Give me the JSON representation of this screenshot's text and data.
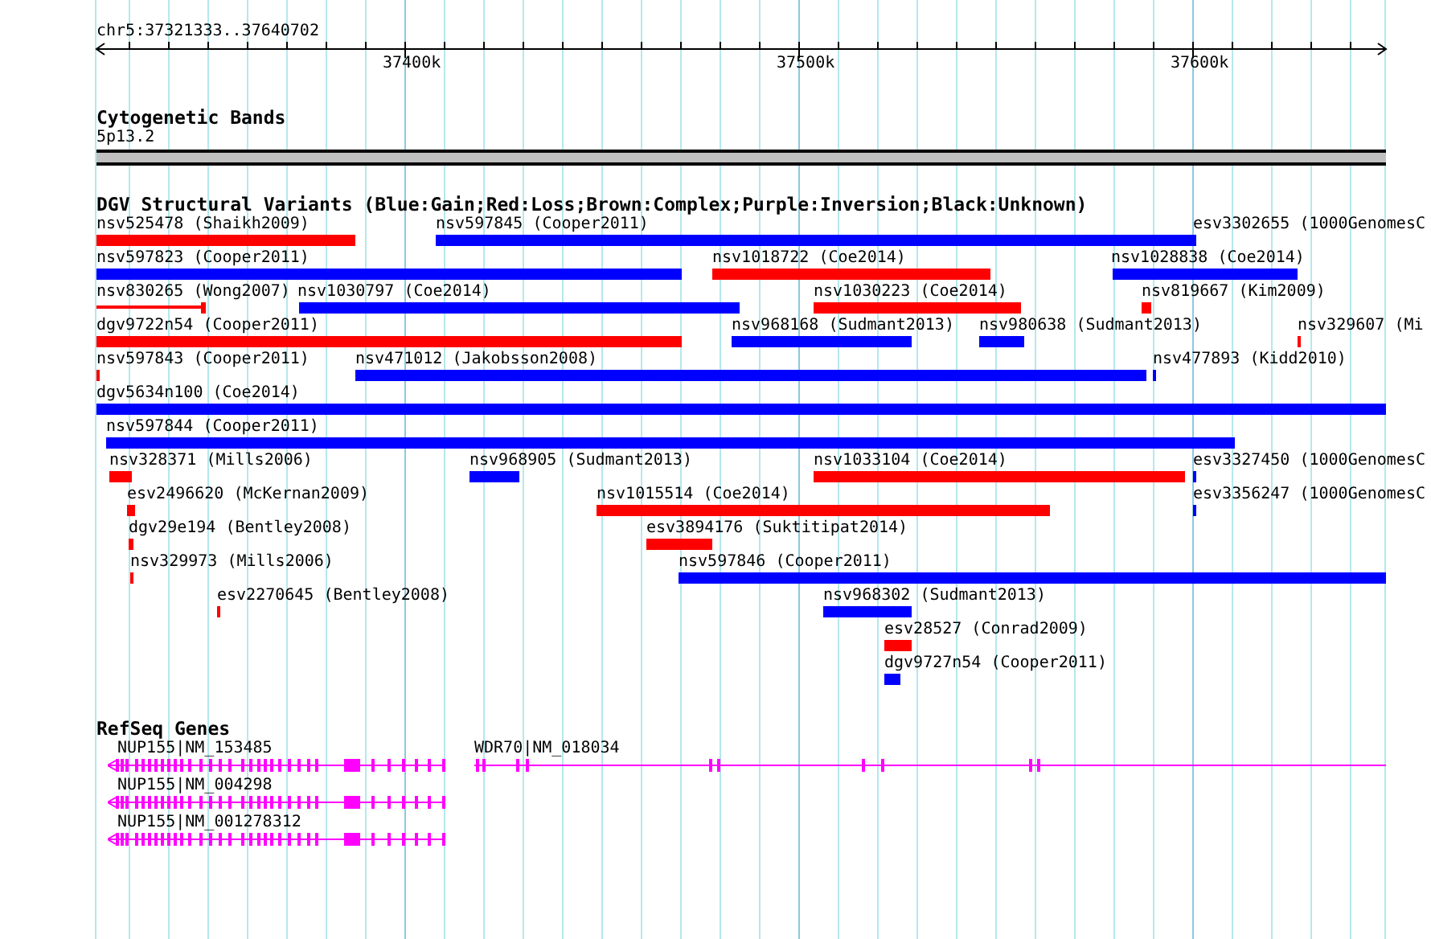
{
  "ruler": {
    "region": "chr5:37321333..37640702",
    "ticks": [
      "37400k",
      "37500k",
      "37600k"
    ]
  },
  "cytogenetic_bands": {
    "title": "Cytogenetic Bands",
    "band": "5p13.2"
  },
  "dgv": {
    "title": "DGV Structural Variants (Blue:Gain;Red:Loss;Brown:Complex;Purple:Inversion;Black:Unknown)",
    "rows": [
      [
        {
          "label": "nsv525478 (Shaikh2009)",
          "color": "#ff0000"
        },
        {
          "label": "nsv597845 (Cooper2011)",
          "color": "#0000ff"
        },
        {
          "label": "esv3302655 (1000GenomesC",
          "color": "#0000ff"
        }
      ],
      [
        {
          "label": "nsv597823 (Cooper2011)",
          "color": "#0000ff"
        },
        {
          "label": "nsv1018722 (Coe2014)",
          "color": "#ff0000"
        },
        {
          "label": "nsv1028838 (Coe2014)",
          "color": "#0000ff"
        }
      ],
      [
        {
          "label": "nsv830265 (Wong2007)",
          "color": "#ff0000"
        },
        {
          "label": "nsv1030797 (Coe2014)",
          "color": "#0000ff"
        },
        {
          "label": "nsv1030223 (Coe2014)",
          "color": "#ff0000"
        },
        {
          "label": "nsv819667 (Kim2009)",
          "color": "#ff0000"
        }
      ],
      [
        {
          "label": "dgv9722n54 (Cooper2011)",
          "color": "#ff0000"
        },
        {
          "label": "nsv968168 (Sudmant2013)",
          "color": "#0000ff"
        },
        {
          "label": "nsv980638 (Sudmant2013)",
          "color": "#0000ff"
        },
        {
          "label": "nsv329607 (Mi",
          "color": "#ff0000"
        }
      ],
      [
        {
          "label": "nsv597843 (Cooper2011)",
          "color": "#ff0000"
        },
        {
          "label": "nsv471012 (Jakobsson2008)",
          "color": "#0000ff"
        },
        {
          "label": "nsv477893 (Kidd2010)",
          "color": "#0000ff"
        }
      ],
      [
        {
          "label": "dgv5634n100 (Coe2014)",
          "color": "#0000ff"
        }
      ],
      [
        {
          "label": "nsv597844 (Cooper2011)",
          "color": "#0000ff"
        }
      ],
      [
        {
          "label": "nsv328371 (Mills2006)",
          "color": "#ff0000"
        },
        {
          "label": "nsv968905 (Sudmant2013)",
          "color": "#0000ff"
        },
        {
          "label": "nsv1033104 (Coe2014)",
          "color": "#ff0000"
        },
        {
          "label": "esv3327450 (1000GenomesC",
          "color": "#0000ff"
        }
      ],
      [
        {
          "label": "esv2496620 (McKernan2009)",
          "color": "#ff0000"
        },
        {
          "label": "nsv1015514 (Coe2014)",
          "color": "#ff0000"
        },
        {
          "label": "esv3356247 (1000GenomesC",
          "color": "#0000ff"
        }
      ],
      [
        {
          "label": "dgv29e194 (Bentley2008)",
          "color": "#ff0000"
        },
        {
          "label": "esv3894176 (Suktitipat2014)",
          "color": "#ff0000"
        }
      ],
      [
        {
          "label": "nsv329973 (Mills2006)",
          "color": "#ff0000"
        },
        {
          "label": "nsv597846 (Cooper2011)",
          "color": "#0000ff"
        }
      ],
      [
        {
          "label": "esv2270645 (Bentley2008)",
          "color": "#ff0000"
        },
        {
          "label": "nsv968302 (Sudmant2013)",
          "color": "#0000ff"
        }
      ],
      [
        {
          "label": "esv28527 (Conrad2009)",
          "color": "#ff0000"
        }
      ],
      [
        {
          "label": "dgv9727n54 (Cooper2011)",
          "color": "#0000ff"
        }
      ]
    ]
  },
  "refseq": {
    "title": "RefSeq Genes",
    "genes": [
      {
        "label": "NUP155|NM_153485"
      },
      {
        "label": "WDR70|NM_018034"
      },
      {
        "label": "NUP155|NM_004298"
      },
      {
        "label": "NUP155|NM_001278312"
      }
    ]
  }
}
